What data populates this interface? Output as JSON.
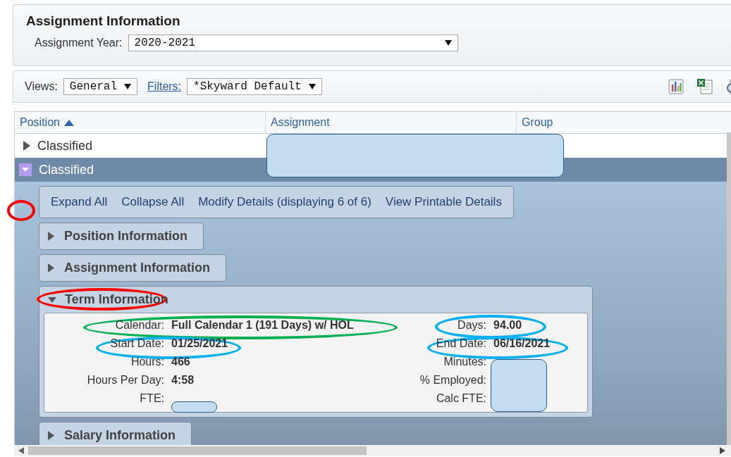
{
  "header": {
    "title": "Assignment Information",
    "year_label": "Assignment Year:",
    "year_value": "2020-2021"
  },
  "toolbar": {
    "views_label": "Views:",
    "views_value": "General",
    "filters_link": "Filters:",
    "filters_value": "*Skyward Default"
  },
  "table": {
    "columns": [
      {
        "label": "Position",
        "sorted": true
      },
      {
        "label": "Assignment",
        "sorted": false
      },
      {
        "label": "Group",
        "sorted": false
      }
    ],
    "rows": [
      {
        "position": "Classified",
        "expanded": false,
        "selected": false
      },
      {
        "position": "Classified",
        "expanded": true,
        "selected": true
      }
    ]
  },
  "detail_links": [
    "Expand All",
    "Collapse All",
    "Modify Details (displaying 6 of 6)",
    "View Printable Details"
  ],
  "sections": [
    {
      "title": "Position Information",
      "expanded": false
    },
    {
      "title": "Assignment Information",
      "expanded": false
    },
    {
      "title": "Term Information",
      "expanded": true,
      "fields": [
        {
          "label": "Calendar:",
          "value": "Full Calendar 1 (191 Days) w/ HOL"
        },
        {
          "label": "Days:",
          "value": "94.00"
        },
        {
          "label": "Start Date:",
          "value": "01/25/2021"
        },
        {
          "label": "End Date:",
          "value": "06/16/2021"
        },
        {
          "label": "Hours:",
          "value": "466"
        },
        {
          "label": "Minutes:"
        },
        {
          "label": "Hours Per Day:",
          "value": "4:58"
        },
        {
          "label": "% Employed:"
        },
        {
          "label": "FTE:"
        },
        {
          "label": "Calc FTE:"
        }
      ]
    },
    {
      "title": "Salary Information",
      "expanded": false
    }
  ],
  "annotations": [
    {
      "kind": "redaction"
    },
    {
      "kind": "ellipse",
      "color": "#ff0000"
    },
    {
      "kind": "ellipse",
      "color": "#ff0000"
    },
    {
      "kind": "ellipse",
      "color": "#00b050"
    },
    {
      "kind": "ellipse",
      "color": "#00b0f0"
    },
    {
      "kind": "ellipse",
      "color": "#00b0f0"
    },
    {
      "kind": "ellipse",
      "color": "#00b0f0"
    },
    {
      "kind": "redaction"
    },
    {
      "kind": "redaction"
    }
  ]
}
